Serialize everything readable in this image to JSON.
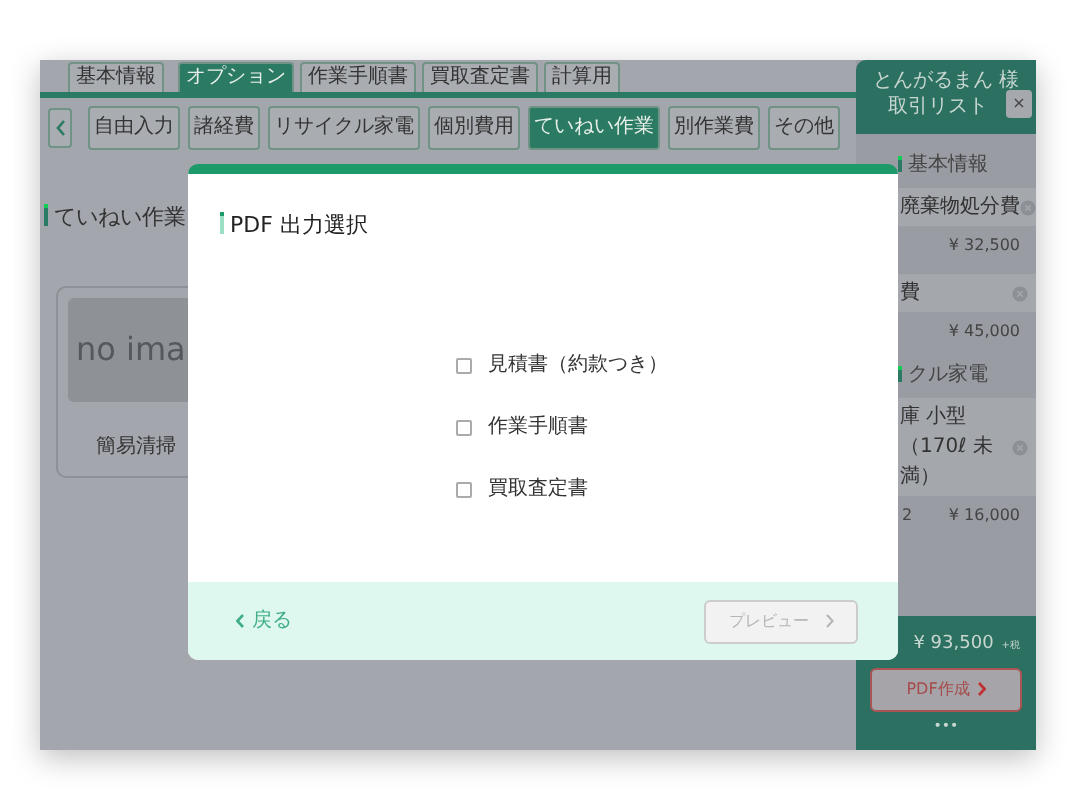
{
  "top_tabs": [
    {
      "label": "基本情報",
      "selected": false
    },
    {
      "label": "オプション",
      "selected": true
    },
    {
      "label": "作業手順書",
      "selected": false
    },
    {
      "label": "買取査定書",
      "selected": false
    },
    {
      "label": "計算用",
      "selected": false
    }
  ],
  "sub_tabs": [
    {
      "label": "自由入力",
      "selected": false
    },
    {
      "label": "諸経費",
      "selected": false
    },
    {
      "label": "リサイクル家電",
      "selected": false
    },
    {
      "label": "個別費用",
      "selected": false
    },
    {
      "label": "ていねい作業",
      "selected": true
    },
    {
      "label": "別作業費",
      "selected": false
    },
    {
      "label": "その他",
      "selected": false
    }
  ],
  "section_title": "ていねい作業",
  "product_card": {
    "image_text": "no ima",
    "name": "簡易清掃"
  },
  "cart": {
    "customer": "とんがるまん 様",
    "title": "取引リスト",
    "close": "×",
    "groups": [
      {
        "label": "基本情報",
        "items": [
          {
            "name": "廃棄物処分費",
            "price": "¥ 32,500"
          },
          {
            "name": "費",
            "price": "¥ 45,000"
          }
        ]
      },
      {
        "label": "クル家電",
        "items": [
          {
            "name": "庫 小型（170ℓ 未満）",
            "qty": "2",
            "price": "¥ 16,000"
          }
        ]
      }
    ],
    "total": "¥ 93,500",
    "tax_note": "+税",
    "pdf_button": "PDF作成",
    "more": "•••"
  },
  "modal": {
    "title": "PDF 出力選択",
    "options": [
      {
        "label": "見積書（約款つき）",
        "checked": false
      },
      {
        "label": "作業手順書",
        "checked": false
      },
      {
        "label": "買取査定書",
        "checked": false
      }
    ],
    "back": "戻る",
    "preview": {
      "label": "プレビュー",
      "disabled": true
    }
  }
}
